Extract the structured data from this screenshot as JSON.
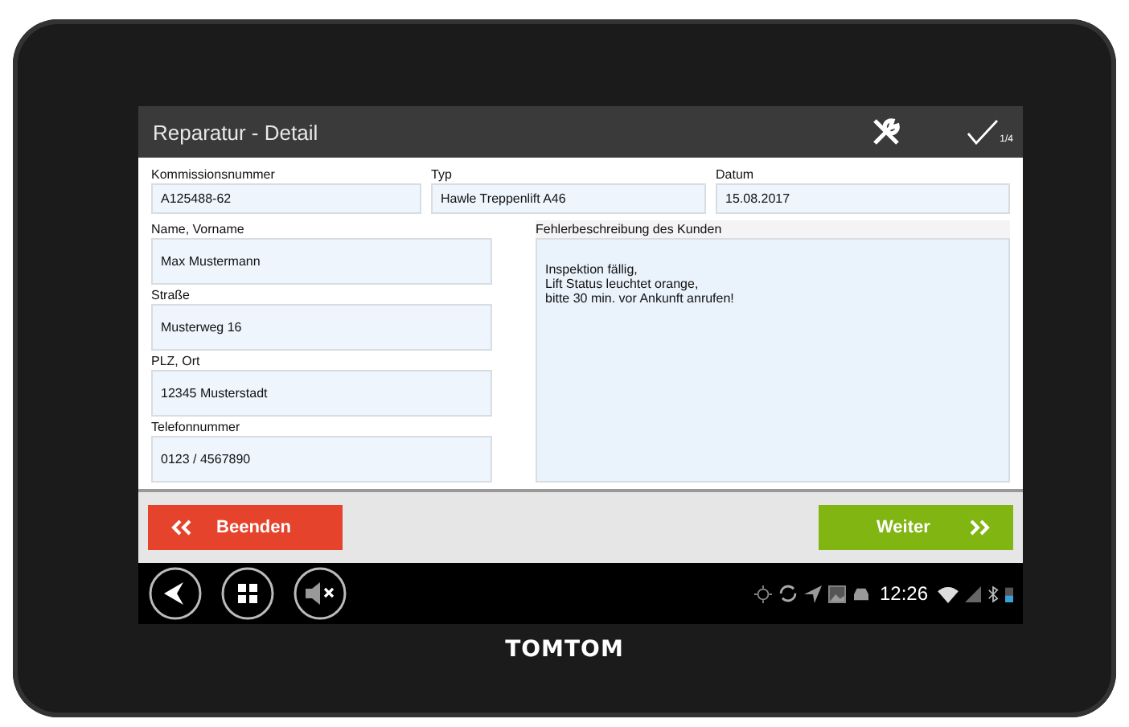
{
  "title": "Reparatur - Detail",
  "progress": "1/4",
  "top_fields": [
    {
      "label": "Kommissionsnummer",
      "value": "A125488-62"
    },
    {
      "label": "Typ",
      "value": "Hawle Treppenlift A46"
    },
    {
      "label": "Datum",
      "value": "15.08.2017"
    }
  ],
  "left_fields": [
    {
      "label": "Name, Vorname",
      "value": "Max Mustermann"
    },
    {
      "label": "Straße",
      "value": "Musterweg 16"
    },
    {
      "label": "PLZ, Ort",
      "value": "12345 Musterstadt"
    },
    {
      "label": "Telefonnummer",
      "value": "0123 / 4567890"
    }
  ],
  "description": {
    "label": "Fehlerbeschreibung des Kunden",
    "value": "Inspektion fällig,\nLift Status leuchtet orange,\nbitte 30 min. vor Ankunft anrufen!"
  },
  "buttons": [
    {
      "kind": "back",
      "label": "Beenden"
    },
    {
      "kind": "next",
      "label": "Weiter"
    }
  ],
  "status_bar": {
    "time": "12:26"
  },
  "brand": "TOMTOM"
}
